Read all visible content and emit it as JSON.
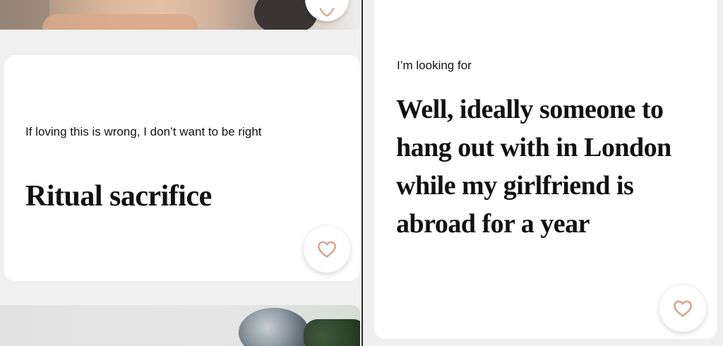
{
  "left_panel": {
    "prompt_card": {
      "prompt": "If loving this is wrong, I don’t want to be right",
      "answer": "Ritual sacrifice",
      "like_icon": "heart-outline-icon"
    }
  },
  "right_panel": {
    "prompt_card": {
      "prompt": "I’m looking for",
      "answer": "Well, ideally someone to hang out with in London while my girlfriend is abroad for a year",
      "like_icon": "heart-outline-icon"
    }
  },
  "colors": {
    "heart_outline": "#d9a48f",
    "card_background": "#ffffff",
    "page_background": "#efefef"
  }
}
